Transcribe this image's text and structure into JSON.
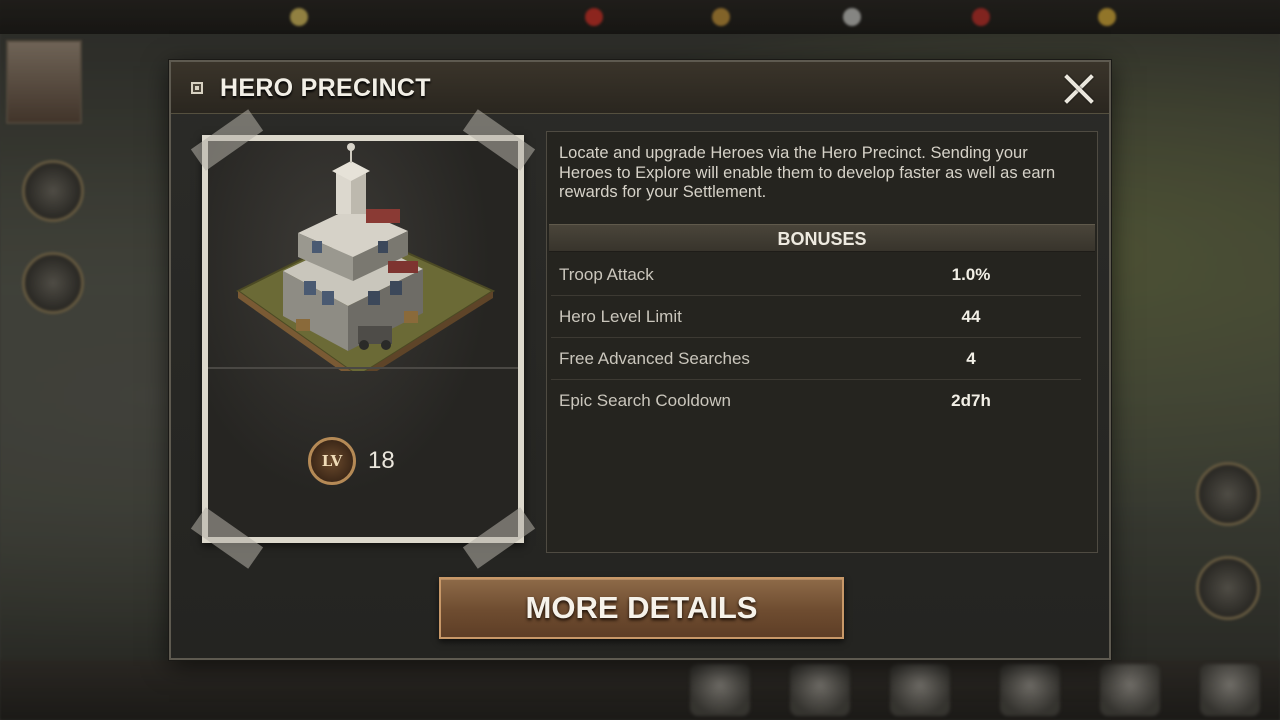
{
  "dialog": {
    "title": "HERO PRECINCT",
    "description": "Locate and upgrade Heroes via the Hero Precinct. Sending your Heroes to Explore will enable them to develop faster as well as earn rewards for your Settlement.",
    "bonuses_header": "BONUSES",
    "bonuses": [
      {
        "name": "Troop Attack",
        "value": "1.0%"
      },
      {
        "name": "Hero Level Limit",
        "value": "44"
      },
      {
        "name": "Free Advanced Searches",
        "value": "4"
      },
      {
        "name": "Epic Search Cooldown",
        "value": "2d7h"
      }
    ],
    "level_badge": "LV",
    "level": "18",
    "more_details_label": "MORE DETAILS"
  },
  "colors": {
    "button": "#7a5636",
    "panel": "#25241f",
    "title_bar": "#33302a"
  },
  "icons": {
    "close": "close-icon",
    "level": "level-badge-icon"
  }
}
